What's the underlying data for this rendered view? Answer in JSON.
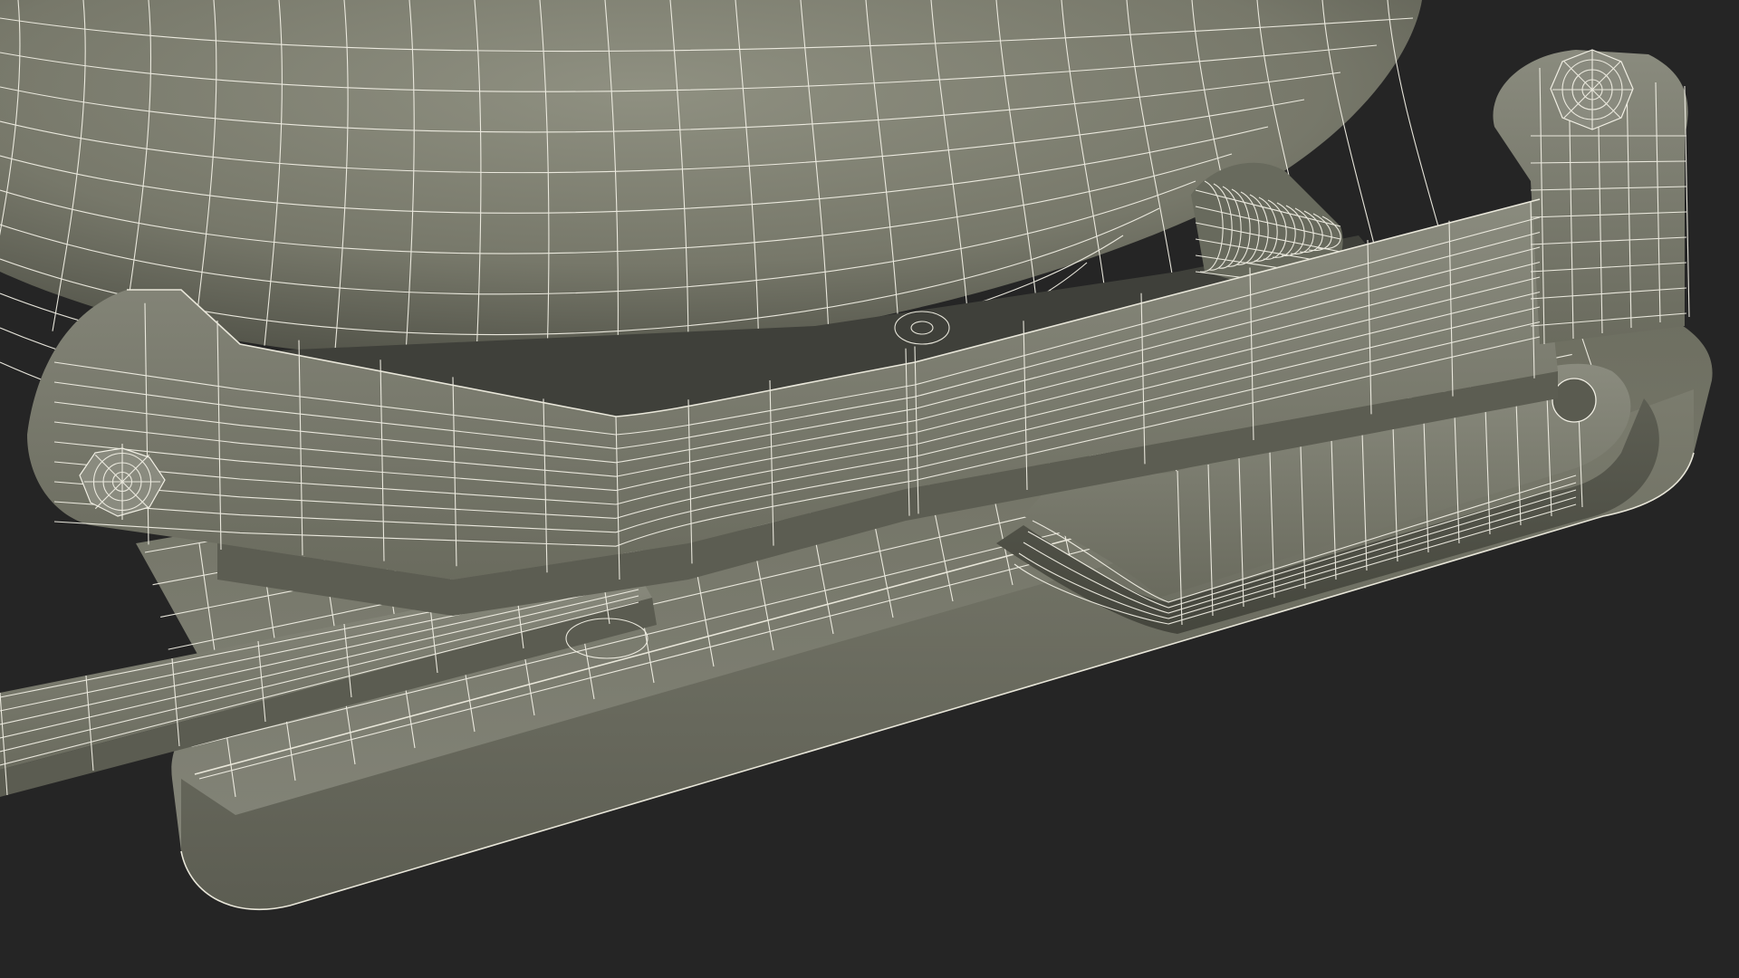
{
  "scene": {
    "background_color": "#252525",
    "surface_color": "#7a7b6c",
    "surface_shadow_color": "#4f5046",
    "wireframe_color": "#f1efe4",
    "objects": [
      "sphere-shell",
      "base-plate",
      "curved-lever-arm",
      "flat-bar",
      "u-shaped-bracket",
      "hex-bolt",
      "coil-spring",
      "hex-nut"
    ]
  }
}
